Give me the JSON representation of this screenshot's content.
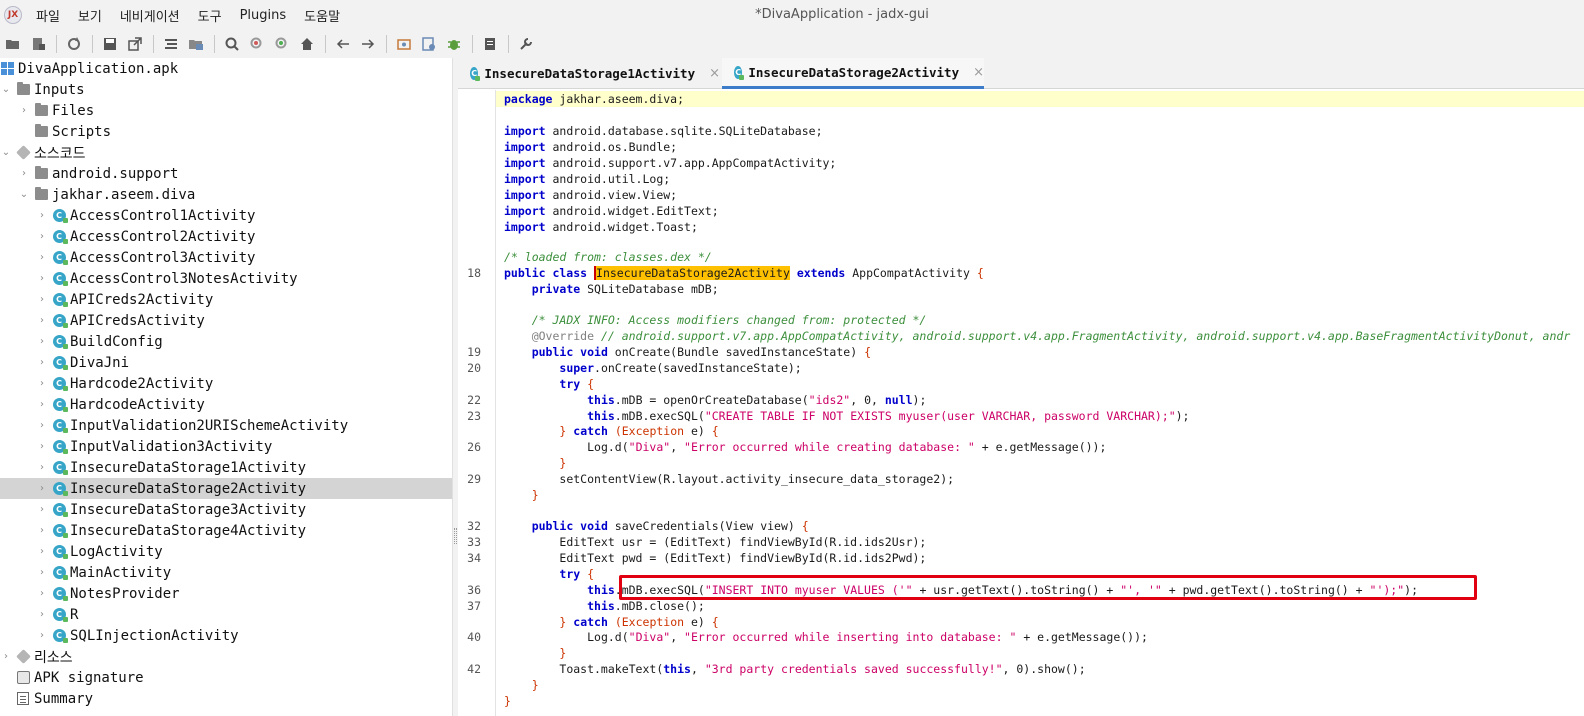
{
  "window": {
    "title": "*DivaApplication - jadx-gui",
    "app_icon_text": "JX"
  },
  "menu": [
    "파일",
    "보기",
    "네비게이션",
    "도구",
    "Plugins",
    "도움말"
  ],
  "toolbar_icons": [
    "open-file-icon",
    "add-files-icon",
    "sync-icon",
    "save-icon",
    "export-icon",
    "sync-tree-icon",
    "flatten-packages-icon",
    "search-icon",
    "find-usage-icon",
    "find-class-icon",
    "home-icon",
    "back-icon",
    "forward-icon",
    "quark-icon",
    "deobfuscation-icon",
    "debugger-icon",
    "log-viewer-icon",
    "preferences-icon"
  ],
  "tree": {
    "root": "DivaApplication.apk",
    "inputs": "Inputs",
    "files": "Files",
    "scripts": "Scripts",
    "source_code": "소스코드",
    "pkg_support": "android.support",
    "pkg_diva": "jakhar.aseem.diva",
    "classes": [
      "AccessControl1Activity",
      "AccessControl2Activity",
      "AccessControl3Activity",
      "AccessControl3NotesActivity",
      "APICreds2Activity",
      "APICredsActivity",
      "BuildConfig",
      "DivaJni",
      "Hardcode2Activity",
      "HardcodeActivity",
      "InputValidation2URISchemeActivity",
      "InputValidation3Activity",
      "InsecureDataStorage1Activity",
      "InsecureDataStorage2Activity",
      "InsecureDataStorage3Activity",
      "InsecureDataStorage4Activity",
      "LogActivity",
      "MainActivity",
      "NotesProvider",
      "R",
      "SQLInjectionActivity"
    ],
    "selected_class": "InsecureDataStorage2Activity",
    "resources": "리소스",
    "apk_signature": "APK signature",
    "summary": "Summary"
  },
  "tabs": [
    {
      "label": "InsecureDataStorage1Activity",
      "active": false
    },
    {
      "label": "InsecureDataStorage2Activity",
      "active": true
    }
  ],
  "code": {
    "package_kw": "package",
    "package_name": " jakhar.aseem.diva;",
    "imports": [
      " android.database.sqlite.SQLiteDatabase;",
      " android.os.Bundle;",
      " android.support.v7.app.AppCompatActivity;",
      " android.util.Log;",
      " android.view.View;",
      " android.widget.EditText;",
      " android.widget.Toast;"
    ],
    "loaded_from_comment": "/* loaded from: classes.dex */",
    "class_name": "InsecureDataStorage2Activity",
    "superclass": "AppCompatActivity",
    "field_decl": " SQLiteDatabase mDB;",
    "jadx_info_comment": "/* JADX INFO: Access modifiers changed from: protected */",
    "override_annotation": "@Override",
    "override_comment": " // android.support.v7.app.AppCompatActivity, android.support.v4.app.FragmentActivity, android.support.v4.app.BaseFragmentActivityDonut, andr",
    "oncreate_sig": " onCreate(Bundle savedInstanceState) ",
    "super_call": ".onCreate(savedInstanceState);",
    "open_db_pre": ".mDB = openOrCreateDatabase(",
    "db_name": "\"ids2\"",
    "open_db_mid": ", 0, ",
    "open_db_post": ");",
    "exec_create_pre": ".mDB.execSQL(",
    "create_sql": "\"CREATE TABLE IF NOT EXISTS myuser(user VARCHAR, password VARCHAR);\"",
    "call_close": ");",
    "log_pre": "Log.d(",
    "log_tag": "\"Diva\"",
    "log_create_msg": "\"Error occurred while creating database: \"",
    "log_post": " + e.getMessage());",
    "set_content_view": "setContentView(R.layout.activity_insecure_data_storage2);",
    "save_sig": " saveCredentials(View view) ",
    "usr_line": "EditText usr = (EditText) findViewById(R.id.ids2Usr);",
    "pwd_line": "EditText pwd = (EditText) findViewById(R.id.ids2Pwd);",
    "exec_insert_pre": ".mDB.execSQL(",
    "insert_sql_1": "\"INSERT INTO myuser VALUES ('\"",
    "insert_mid_1": " + usr.getText().toString() + ",
    "insert_sql_2": "\"', '\"",
    "insert_mid_2": " + pwd.getText().toString() + ",
    "insert_sql_3": "\"');\"",
    "close_line": ".mDB.close();",
    "log_insert_msg": "\"Error occurred while inserting into database: \"",
    "toast_pre": "Toast.makeText(",
    "toast_msg": "\"3rd party credentials saved successfully!\"",
    "toast_post": ", 0).show();",
    "exception_type": "(Exception",
    "exception_var": " e) "
  },
  "line_numbers": [
    "18",
    "19",
    "20",
    "22",
    "23",
    "26",
    "29",
    "32",
    "33",
    "34",
    "36",
    "37",
    "40",
    "42"
  ],
  "colors": {
    "highlight_box": "#e00010",
    "selection": "#ffc000",
    "keyword": "#0000cc",
    "string": "#cc0066",
    "comment": "#3c8f3c"
  }
}
